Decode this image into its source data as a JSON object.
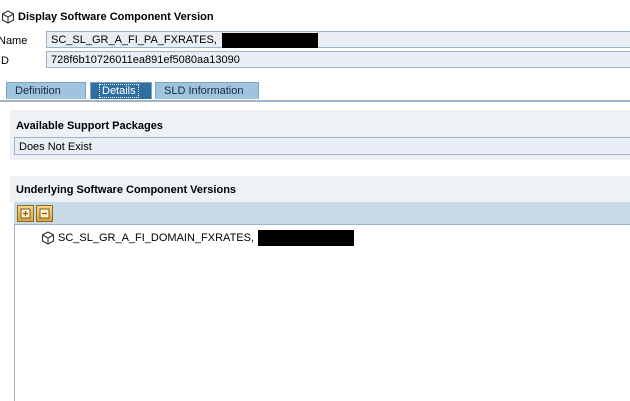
{
  "header": {
    "icon": "component-cube-icon",
    "title": "Display Software Component Version"
  },
  "fields": {
    "name_label": "Name",
    "name_value": "SC_SL_GR_A_FI_PA_FXRATES,",
    "id_label": "ID",
    "id_value": "728f6b10726011ea891ef5080aa13090"
  },
  "tabs": [
    {
      "label": "Definition",
      "active": false
    },
    {
      "label": "Details",
      "active": true
    },
    {
      "label": "SLD Information",
      "active": false
    }
  ],
  "support_packages": {
    "heading": "Available Support Packages",
    "value": "Does Not Exist"
  },
  "underlying": {
    "heading": "Underlying Software Component Versions",
    "toolbar": [
      "expand-icon",
      "collapse-icon"
    ],
    "items": [
      {
        "label": "SC_SL_GR_A_FI_DOMAIN_FXRATES,",
        "icon": "component-cube-icon"
      }
    ]
  },
  "colors": {
    "tab_active": "#2f6ea3",
    "tab_inactive": "#9fc4e0",
    "field_bg": "#e8eef4",
    "border": "#9fb3c8",
    "redaction": "#000000"
  }
}
